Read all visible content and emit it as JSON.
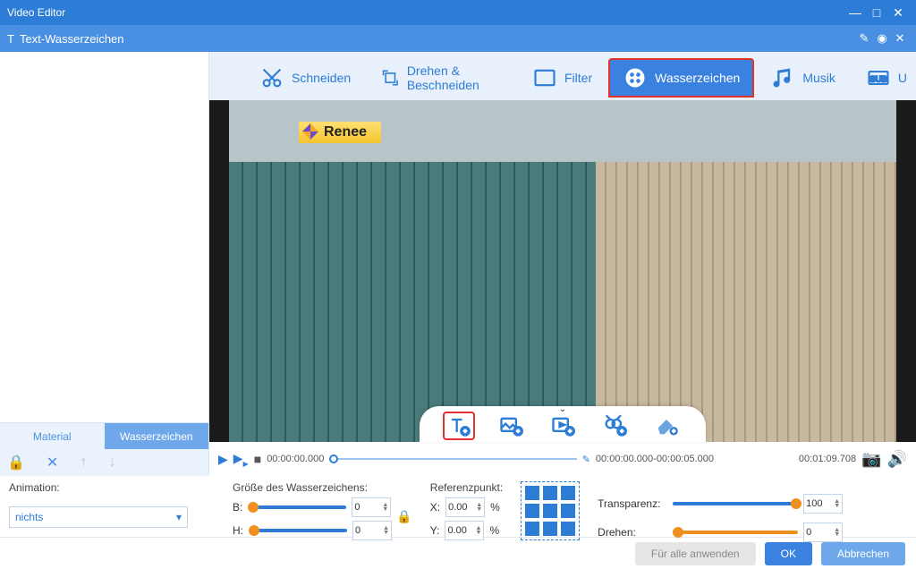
{
  "title": "Video Editor",
  "side_header": {
    "label": "Text-Wasserzeichen"
  },
  "top_tabs": [
    {
      "label": "Schneiden"
    },
    {
      "label": "Drehen & Beschneiden"
    },
    {
      "label": "Filter"
    },
    {
      "label": "Wasserzeichen"
    },
    {
      "label": "Musik"
    },
    {
      "label": "U"
    }
  ],
  "watermark_text": "Renee",
  "left_tabs": {
    "material": "Material",
    "wm": "Wasserzeichen"
  },
  "timeline": {
    "start": "00:00:00.000",
    "range": "00:00:00.000-00:00:05.000",
    "end": "00:01:09.708"
  },
  "panel": {
    "animation_label": "Animation:",
    "animation_value": "nichts",
    "size_label": "Größe des Wasserzeichens:",
    "b_label": "B:",
    "h_label": "H:",
    "b_value": "0",
    "h_value": "0",
    "ref_label": "Referenzpunkt:",
    "x_label": "X:",
    "y_label": "Y:",
    "x_value": "0.00",
    "y_value": "0.00",
    "pct": "%",
    "transp_label": "Transparenz:",
    "transp_value": "100",
    "rotate_label": "Drehen:",
    "rotate_value": "0"
  },
  "footer": {
    "apply_all": "Für alle anwenden",
    "ok": "OK",
    "cancel": "Abbrechen"
  }
}
